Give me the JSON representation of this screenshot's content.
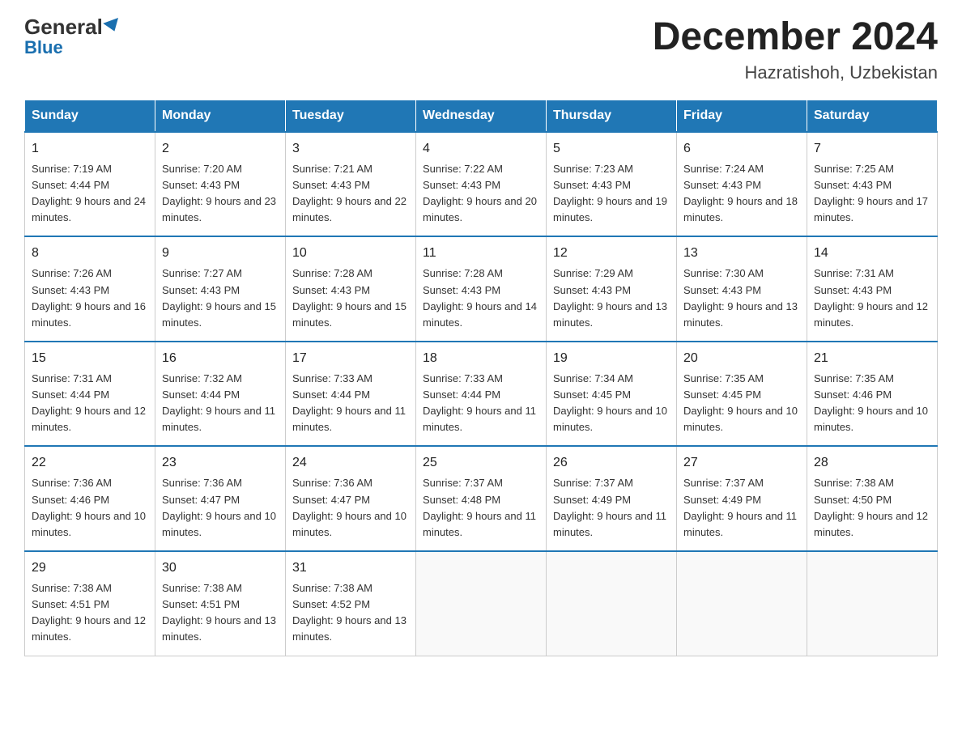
{
  "header": {
    "logo_top": "General",
    "logo_bottom": "Blue",
    "month_title": "December 2024",
    "location": "Hazratishoh, Uzbekistan"
  },
  "weekdays": [
    "Sunday",
    "Monday",
    "Tuesday",
    "Wednesday",
    "Thursday",
    "Friday",
    "Saturday"
  ],
  "weeks": [
    [
      {
        "day": "1",
        "sunrise": "7:19 AM",
        "sunset": "4:44 PM",
        "daylight": "9 hours and 24 minutes."
      },
      {
        "day": "2",
        "sunrise": "7:20 AM",
        "sunset": "4:43 PM",
        "daylight": "9 hours and 23 minutes."
      },
      {
        "day": "3",
        "sunrise": "7:21 AM",
        "sunset": "4:43 PM",
        "daylight": "9 hours and 22 minutes."
      },
      {
        "day": "4",
        "sunrise": "7:22 AM",
        "sunset": "4:43 PM",
        "daylight": "9 hours and 20 minutes."
      },
      {
        "day": "5",
        "sunrise": "7:23 AM",
        "sunset": "4:43 PM",
        "daylight": "9 hours and 19 minutes."
      },
      {
        "day": "6",
        "sunrise": "7:24 AM",
        "sunset": "4:43 PM",
        "daylight": "9 hours and 18 minutes."
      },
      {
        "day": "7",
        "sunrise": "7:25 AM",
        "sunset": "4:43 PM",
        "daylight": "9 hours and 17 minutes."
      }
    ],
    [
      {
        "day": "8",
        "sunrise": "7:26 AM",
        "sunset": "4:43 PM",
        "daylight": "9 hours and 16 minutes."
      },
      {
        "day": "9",
        "sunrise": "7:27 AM",
        "sunset": "4:43 PM",
        "daylight": "9 hours and 15 minutes."
      },
      {
        "day": "10",
        "sunrise": "7:28 AM",
        "sunset": "4:43 PM",
        "daylight": "9 hours and 15 minutes."
      },
      {
        "day": "11",
        "sunrise": "7:28 AM",
        "sunset": "4:43 PM",
        "daylight": "9 hours and 14 minutes."
      },
      {
        "day": "12",
        "sunrise": "7:29 AM",
        "sunset": "4:43 PM",
        "daylight": "9 hours and 13 minutes."
      },
      {
        "day": "13",
        "sunrise": "7:30 AM",
        "sunset": "4:43 PM",
        "daylight": "9 hours and 13 minutes."
      },
      {
        "day": "14",
        "sunrise": "7:31 AM",
        "sunset": "4:43 PM",
        "daylight": "9 hours and 12 minutes."
      }
    ],
    [
      {
        "day": "15",
        "sunrise": "7:31 AM",
        "sunset": "4:44 PM",
        "daylight": "9 hours and 12 minutes."
      },
      {
        "day": "16",
        "sunrise": "7:32 AM",
        "sunset": "4:44 PM",
        "daylight": "9 hours and 11 minutes."
      },
      {
        "day": "17",
        "sunrise": "7:33 AM",
        "sunset": "4:44 PM",
        "daylight": "9 hours and 11 minutes."
      },
      {
        "day": "18",
        "sunrise": "7:33 AM",
        "sunset": "4:44 PM",
        "daylight": "9 hours and 11 minutes."
      },
      {
        "day": "19",
        "sunrise": "7:34 AM",
        "sunset": "4:45 PM",
        "daylight": "9 hours and 10 minutes."
      },
      {
        "day": "20",
        "sunrise": "7:35 AM",
        "sunset": "4:45 PM",
        "daylight": "9 hours and 10 minutes."
      },
      {
        "day": "21",
        "sunrise": "7:35 AM",
        "sunset": "4:46 PM",
        "daylight": "9 hours and 10 minutes."
      }
    ],
    [
      {
        "day": "22",
        "sunrise": "7:36 AM",
        "sunset": "4:46 PM",
        "daylight": "9 hours and 10 minutes."
      },
      {
        "day": "23",
        "sunrise": "7:36 AM",
        "sunset": "4:47 PM",
        "daylight": "9 hours and 10 minutes."
      },
      {
        "day": "24",
        "sunrise": "7:36 AM",
        "sunset": "4:47 PM",
        "daylight": "9 hours and 10 minutes."
      },
      {
        "day": "25",
        "sunrise": "7:37 AM",
        "sunset": "4:48 PM",
        "daylight": "9 hours and 11 minutes."
      },
      {
        "day": "26",
        "sunrise": "7:37 AM",
        "sunset": "4:49 PM",
        "daylight": "9 hours and 11 minutes."
      },
      {
        "day": "27",
        "sunrise": "7:37 AM",
        "sunset": "4:49 PM",
        "daylight": "9 hours and 11 minutes."
      },
      {
        "day": "28",
        "sunrise": "7:38 AM",
        "sunset": "4:50 PM",
        "daylight": "9 hours and 12 minutes."
      }
    ],
    [
      {
        "day": "29",
        "sunrise": "7:38 AM",
        "sunset": "4:51 PM",
        "daylight": "9 hours and 12 minutes."
      },
      {
        "day": "30",
        "sunrise": "7:38 AM",
        "sunset": "4:51 PM",
        "daylight": "9 hours and 13 minutes."
      },
      {
        "day": "31",
        "sunrise": "7:38 AM",
        "sunset": "4:52 PM",
        "daylight": "9 hours and 13 minutes."
      },
      null,
      null,
      null,
      null
    ]
  ]
}
